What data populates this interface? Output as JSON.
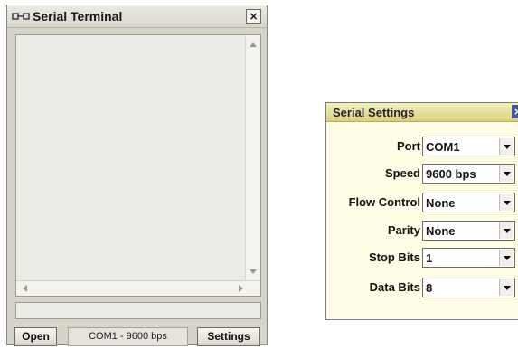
{
  "terminal": {
    "title": "Serial Terminal",
    "close_glyph": "×",
    "open_label": "Open",
    "status": "COM1 - 9600 bps",
    "settings_label": "Settings"
  },
  "settings": {
    "title": "Serial Settings",
    "close_glyph": "×",
    "fields": [
      {
        "label": "Port",
        "value": "COM1"
      },
      {
        "label": "Speed",
        "value": "9600 bps"
      },
      {
        "label": "Flow Control",
        "value": "None"
      },
      {
        "label": "Parity",
        "value": "None"
      },
      {
        "label": "Stop Bits",
        "value": "1"
      },
      {
        "label": "Data Bits",
        "value": "8"
      }
    ]
  },
  "icons": [
    "serial-connector-icon",
    "close-icon",
    "dropdown-arrow-icon",
    "scroll-up-icon",
    "scroll-down-icon",
    "scroll-left-icon",
    "scroll-right-icon"
  ],
  "colors": {
    "window_bg": "#d6d3c9",
    "settings_bg": "#fffde6",
    "settings_titlebar": "#e4dc98"
  }
}
